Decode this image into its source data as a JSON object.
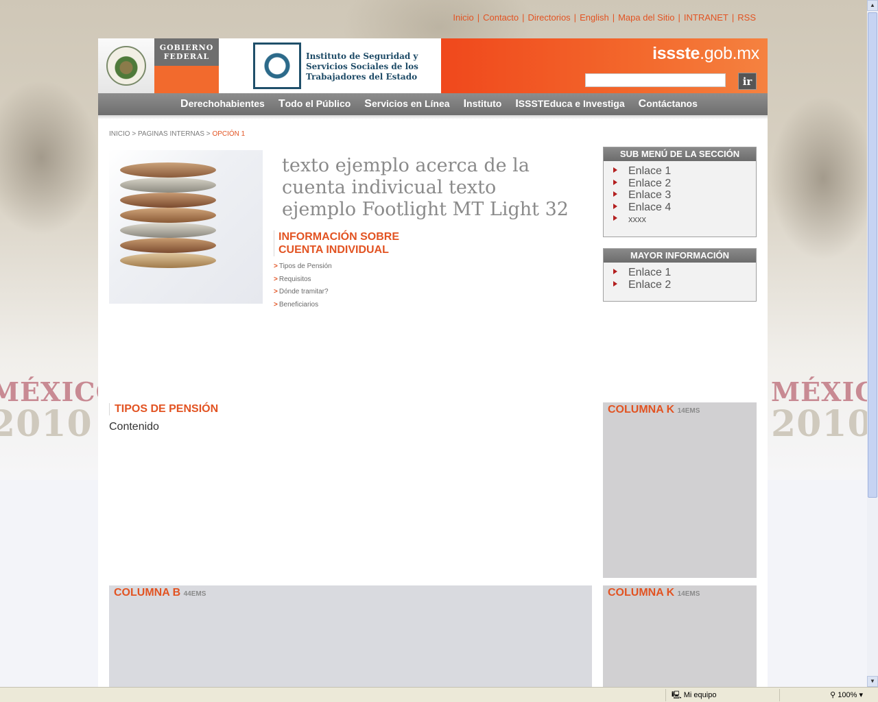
{
  "top_links": [
    "Inicio",
    "Contacto",
    "Directorios",
    "English",
    "Mapa del Sitio",
    "INTRANET",
    "RSS"
  ],
  "header": {
    "gobierno": "GOBIERNO",
    "federal": "FEDERAL",
    "institute_name": "Instituto de Seguridad y Servicios Sociales de los Trabajadores del Estado",
    "site_bold": "issste",
    "site_rest": ".gob.mx",
    "search_button": "ir"
  },
  "nav": [
    "Derechohabientes",
    "Todo el Público",
    "Servicios en Línea",
    "Instituto",
    "ISSSTEduca e Investiga",
    "Contáctanos"
  ],
  "breadcrumb": {
    "home": "INICIO",
    "sep": " > ",
    "section": "PAGINAS INTERNAS",
    "current": "OPCIÓN 1"
  },
  "main": {
    "headline": "texto ejemplo acerca de la cuenta indivicual texto ejemplo Footlight MT Light 32",
    "info_title_1": "INFORMACIÓN SOBRE",
    "info_title_2": "CUENTA INDIVIDUAL",
    "links": [
      "Tipos de Pensión",
      "Requisitos",
      "Dónde tramitar?",
      "Beneficiarios"
    ],
    "link_marker": ">"
  },
  "submenu": {
    "title": "SUB MENÚ DE LA SECCIÓN",
    "items": [
      "Enlace 1",
      "Enlace 2",
      "Enlace 3",
      "Enlace 4",
      "xxxx"
    ]
  },
  "mayor": {
    "title": "MAYOR INFORMACIÓN",
    "items": [
      "Enlace 1",
      "Enlace 2"
    ]
  },
  "section": {
    "title": "TIPOS DE PENSIÓN",
    "content": "Contenido"
  },
  "columns": {
    "k1": {
      "title": "COLUMNA K",
      "size": "14EMS"
    },
    "b": {
      "title": "COLUMNA B",
      "size": "44EMS"
    },
    "k2": {
      "title": "COLUMNA K",
      "size": "14EMS"
    }
  },
  "background": {
    "mexico": "MÉXICO",
    "year": "2010"
  },
  "status_bar": {
    "zone": "Mi equipo",
    "zoom": "100%"
  },
  "colors": {
    "accent": "#e25322",
    "header_orange": "#f26a2d",
    "nav_gray": "#7a7a7a",
    "column_gray": "#d1d0d2"
  },
  "icons": [
    "emblem-icon",
    "issste-logo-icon",
    "bullet-triangle-icon",
    "computer-icon",
    "zoom-icon"
  ]
}
